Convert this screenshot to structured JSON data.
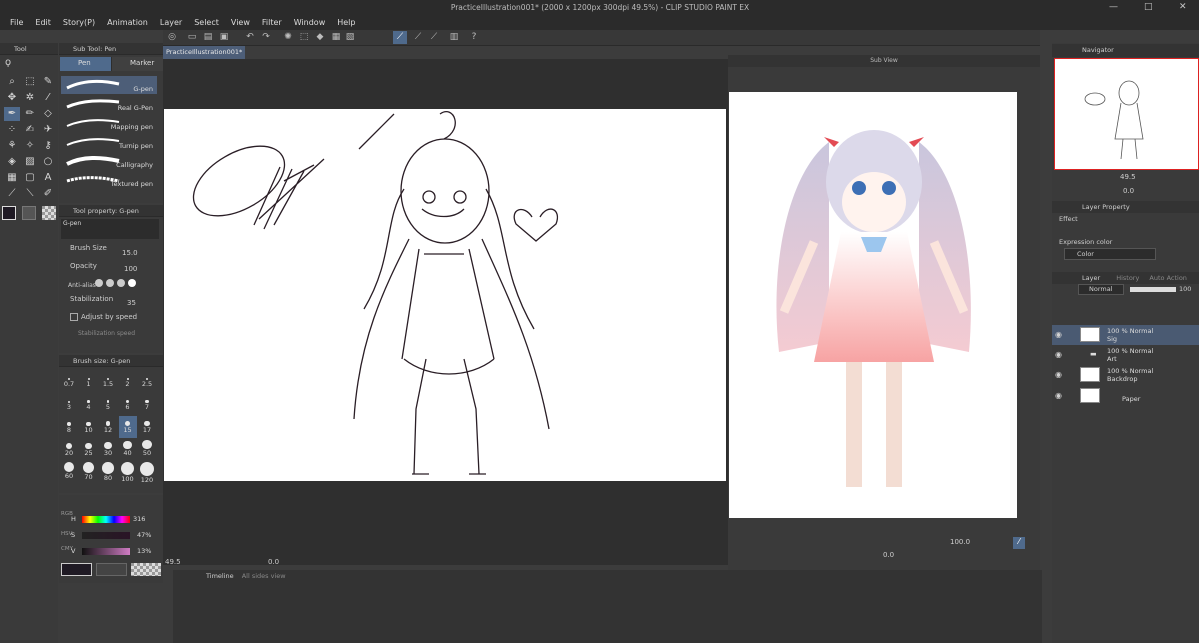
{
  "window": {
    "title": "PracticeIllustration001* (2000 x 1200px 300dpi 49.5%) - CLIP STUDIO PAINT EX",
    "controls": [
      "—",
      "□",
      "✕"
    ]
  },
  "menu": [
    "File",
    "Edit",
    "Story(P)",
    "Animation",
    "Layer",
    "Select",
    "View",
    "Filter",
    "Window",
    "Help"
  ],
  "panels": {
    "tool": "Tool",
    "sub_tool": "Sub Tool: Pen",
    "tool_property": "Tool property: G-pen",
    "brush_size": "Brush size: G-pen",
    "sub_view": "Sub View",
    "navigator": "Navigator",
    "layer_property": "Layer Property",
    "layer": "Layer",
    "history": "History",
    "auto_action": "Auto Action",
    "timeline": "Timeline",
    "all_sides": "All sides view"
  },
  "sub_tool_tabs": [
    "Pen",
    "Marker"
  ],
  "brushes": [
    "G-pen",
    "Real G-Pen",
    "Mapping pen",
    "Turnip pen",
    "Calligraphy",
    "Textured pen"
  ],
  "tool_property": {
    "preset_name": "G-pen",
    "brush_size_label": "Brush Size",
    "brush_size_value": "15.0",
    "opacity_label": "Opacity",
    "opacity_value": "100",
    "antialias_label": "Anti-alias",
    "stabilization_label": "Stabilization",
    "stabilization_value": "35",
    "adjust_label": "Adjust by speed",
    "stab_speed_label": "Stabilization speed"
  },
  "brush_sizes": [
    "0.7",
    "1",
    "1.5",
    "2",
    "2.5",
    "3",
    "4",
    "5",
    "6",
    "7",
    "8",
    "10",
    "12",
    "15",
    "17",
    "20",
    "25",
    "30",
    "40",
    "50",
    "60",
    "70",
    "80",
    "100",
    "120"
  ],
  "brush_size_selected": "15",
  "color": {
    "h_label": "H",
    "h_value": "316",
    "s_label": "S",
    "s_value": "47%",
    "v_label": "V",
    "v_value": "13%",
    "side_labels": [
      "RGB",
      "HSV",
      "CMY"
    ],
    "main_color": "#1f1a24",
    "accent": "#4f6a8c"
  },
  "canvas": {
    "tab_label": "PracticeIllustration001*",
    "zoom": "49.5",
    "angle": "0.0"
  },
  "subview": {
    "zoom": "100.0",
    "angle": "0.0"
  },
  "navigator": {
    "zoom": "49.5",
    "angle": "0.0"
  },
  "layer_property": {
    "effect_label": "Effect",
    "expression_label": "Expression color",
    "expression_value": "Color"
  },
  "layer_panel": {
    "blend_mode": "Normal",
    "opacity": "100",
    "layers": [
      {
        "line1": "100 % Normal",
        "line2": "Sig",
        "selected": true
      },
      {
        "line1": "100 % Normal",
        "line2": "Art",
        "selected": false
      },
      {
        "line1": "100 % Normal",
        "line2": "Backdrop",
        "selected": false
      },
      {
        "line1": "",
        "line2": "Paper",
        "selected": false
      }
    ]
  }
}
